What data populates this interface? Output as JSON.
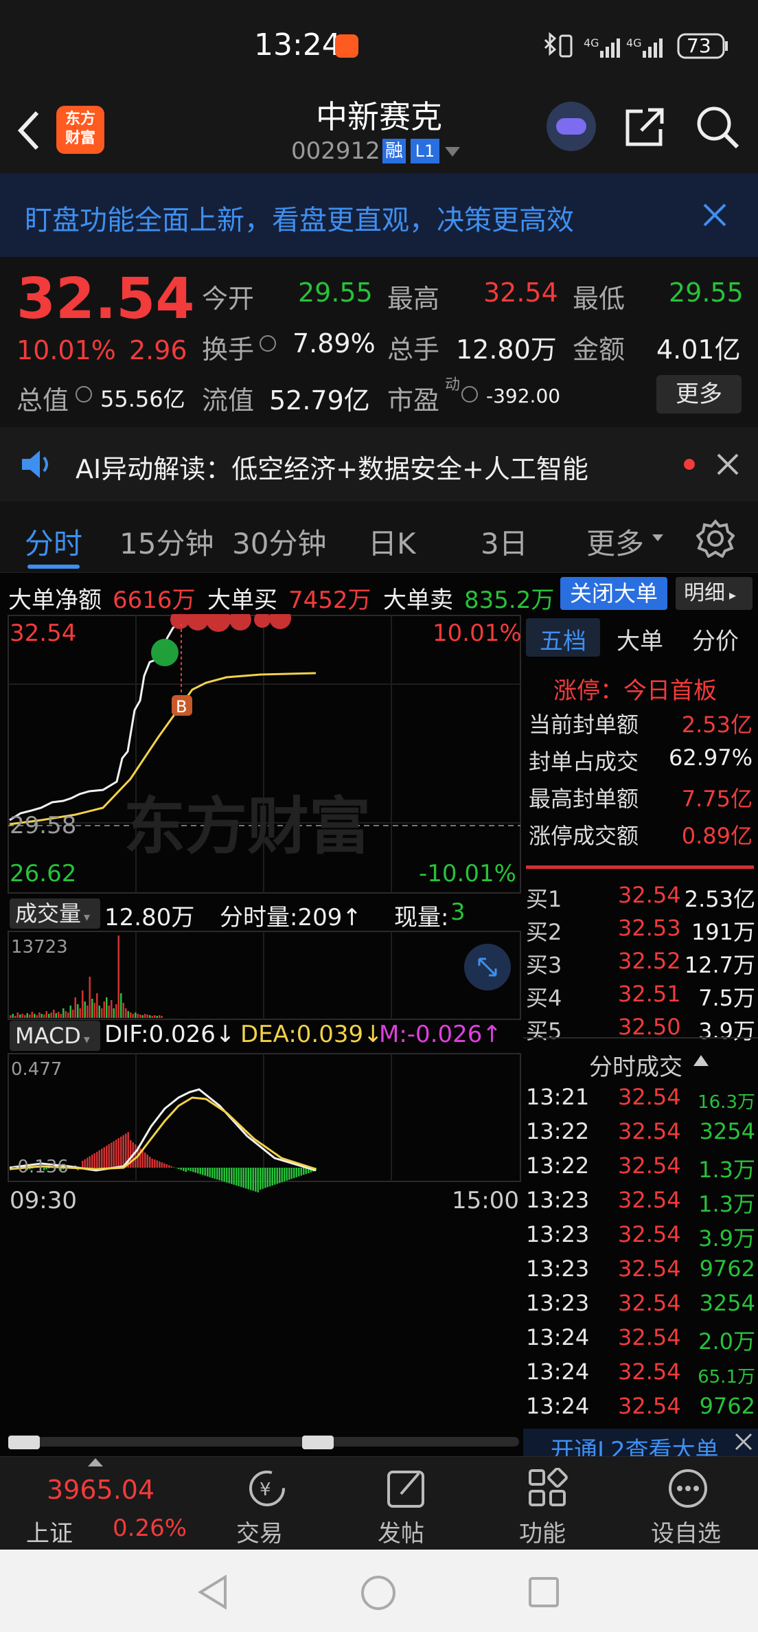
{
  "status": {
    "time": "13:24",
    "battery": "73",
    "net1": "4G",
    "net2": "4G"
  },
  "header": {
    "logo": "东方\n财富",
    "stock_name": "中新赛克",
    "stock_code": "002912",
    "badge_rong": "融",
    "badge_l1": "L1"
  },
  "banner": {
    "text": "盯盘功能全面上新，看盘更直观，决策更高效"
  },
  "quote": {
    "price": "32.54",
    "change_pct": "10.01%",
    "change_amt": "2.96",
    "open_label": "今开",
    "open": "29.55",
    "high_label": "最高",
    "high": "32.54",
    "low_label": "最低",
    "low": "29.55",
    "turnover_label": "换手",
    "turnover": "7.89%",
    "volume_label": "总手",
    "volume": "12.80万",
    "amount_label": "金额",
    "amount": "4.01亿",
    "mktcap_label": "总值",
    "mktcap": "55.56亿",
    "float_label": "流值",
    "float": "52.79亿",
    "pe_label": "市盈",
    "pe_sup": "动",
    "pe": "-392.00",
    "more": "更多"
  },
  "ai": {
    "text": "AI异动解读：低空经济+数据安全+人工智能"
  },
  "tabs": [
    "分时",
    "15分钟",
    "30分钟",
    "日K",
    "3日",
    "更多"
  ],
  "bigorder": {
    "net_label": "大单净额",
    "net": "6616万",
    "buy_label": "大单买",
    "buy": "7452万",
    "sell_label": "大单卖",
    "sell": "835.2万",
    "close_btn": "关闭大单",
    "detail_btn": "明细"
  },
  "chart": {
    "price_top": "32.54",
    "pct_top": "10.01%",
    "price_mid": "29.58",
    "price_bottom": "26.62",
    "pct_bottom": "-10.01%",
    "watermark": "东方财富",
    "marker": "B",
    "vol_label": "成交量",
    "vol_total": "12.80万",
    "vol_min": "分时量:209↑",
    "vol_now_label": "现量:",
    "vol_now": "3",
    "vol_max": "13723",
    "macd_label": "MACD",
    "dif": "DIF:0.026↓",
    "dea": "DEA:0.039↓",
    "m": "M:-0.026↑",
    "macd_max": "0.477",
    "macd_min": "-0.136",
    "time_start": "09:30",
    "time_end": "15:00"
  },
  "panel": {
    "tabs": [
      "五档",
      "大单",
      "分价"
    ],
    "limit_title": "涨停：今日首板",
    "stats": [
      {
        "label": "当前封单额",
        "value": "2.53亿",
        "color": "red"
      },
      {
        "label": "封单占成交",
        "value": "62.97%",
        "color": "white"
      },
      {
        "label": "最高封单额",
        "value": "7.75亿",
        "color": "red"
      },
      {
        "label": "涨停成交额",
        "value": "0.89亿",
        "color": "red"
      }
    ],
    "bids": [
      {
        "label": "买1",
        "price": "32.54",
        "vol": "2.53亿"
      },
      {
        "label": "买2",
        "price": "32.53",
        "vol": "191万"
      },
      {
        "label": "买3",
        "price": "32.52",
        "vol": "12.7万"
      },
      {
        "label": "买4",
        "price": "32.51",
        "vol": "7.5万"
      },
      {
        "label": "买5",
        "price": "32.50",
        "vol": "3.9万"
      }
    ],
    "ticks_title": "分时成交",
    "ticks": [
      {
        "time": "13:21",
        "price": "32.54",
        "vol": "16.3万"
      },
      {
        "time": "13:22",
        "price": "32.54",
        "vol": "3254"
      },
      {
        "time": "13:22",
        "price": "32.54",
        "vol": "1.3万"
      },
      {
        "time": "13:23",
        "price": "32.54",
        "vol": "1.3万"
      },
      {
        "time": "13:23",
        "price": "32.54",
        "vol": "3.9万"
      },
      {
        "time": "13:23",
        "price": "32.54",
        "vol": "9762"
      },
      {
        "time": "13:23",
        "price": "32.54",
        "vol": "3254"
      },
      {
        "time": "13:24",
        "price": "32.54",
        "vol": "2.0万"
      },
      {
        "time": "13:24",
        "price": "32.54",
        "vol": "65.1万"
      },
      {
        "time": "13:24",
        "price": "32.54",
        "vol": "9762"
      }
    ],
    "l2": "开通L2查看大单"
  },
  "index": {
    "name": "上证",
    "value": "3965.04",
    "pct": "0.26%"
  },
  "nav": [
    "交易",
    "发帖",
    "功能",
    "设自选"
  ]
}
